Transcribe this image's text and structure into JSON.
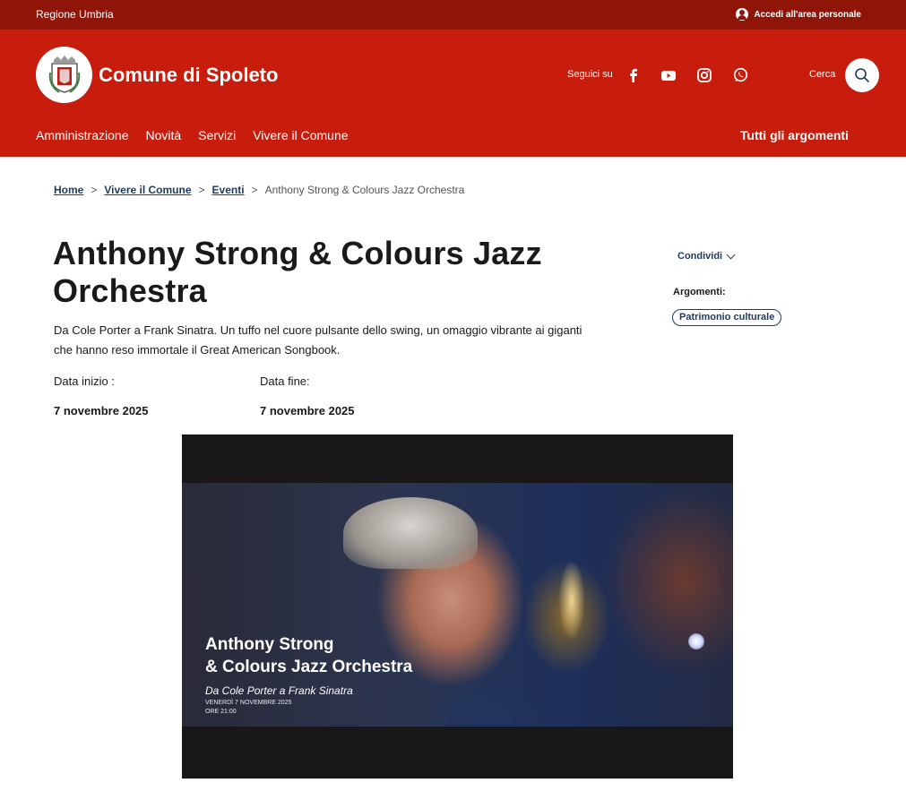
{
  "topbar": {
    "region": "Regione Umbria",
    "login": "Accedi all'area personale"
  },
  "header": {
    "site_title": "Comune di Spoleto",
    "follow_label": "Seguici su",
    "social": [
      "facebook-icon",
      "youtube-icon",
      "instagram-icon",
      "whatsapp-icon"
    ],
    "search_label": "Cerca"
  },
  "nav": {
    "items": [
      "Amministrazione",
      "Novità",
      "Servizi",
      "Vivere il Comune"
    ],
    "all_topics": "Tutti gli argomenti"
  },
  "breadcrumb": {
    "home": "Home",
    "level1": "Vivere il Comune",
    "level2": "Eventi",
    "current": "Anthony Strong & Colours Jazz Orchestra",
    "separator": ">"
  },
  "event": {
    "title": "Anthony Strong & Colours Jazz Orchestra",
    "description": "Da Cole Porter a Frank Sinatra. Un tuffo nel cuore pulsante dello swing, un omaggio vibrante ai giganti che hanno reso immortale il Great American Songbook.",
    "start_label": "Data inizio :",
    "start_value": "7 novembre 2025",
    "end_label": "Data fine:",
    "end_value": "7 novembre 2025"
  },
  "sidebar": {
    "share_label": "Condividi",
    "topics_label": "Argomenti:",
    "topic_chip": "Patrimonio culturale"
  },
  "hero_image": {
    "line1": "Anthony Strong",
    "line2": "& Colours Jazz Orchestra",
    "line3": "Da Cole Porter a Frank Sinatra",
    "line4": "VENERDÌ 7 NOVEMBRE 2025",
    "line5": "ORE 21:00"
  },
  "colors": {
    "topbar": "#8f1508",
    "header": "#c81c0c",
    "link": "#1f3a5f"
  }
}
